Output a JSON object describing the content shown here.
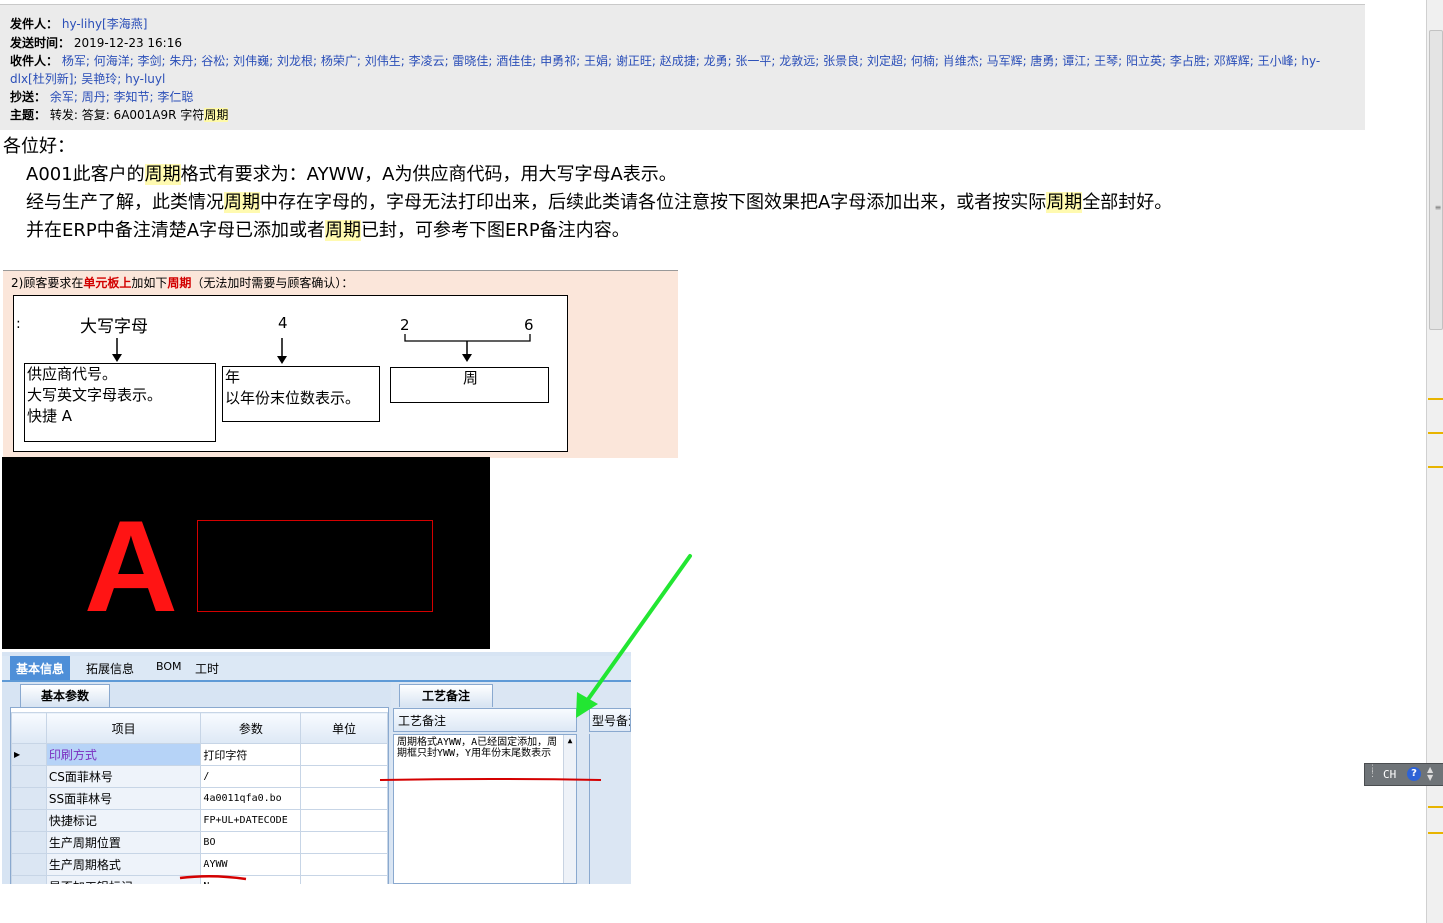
{
  "header": {
    "from_label": "发件人：",
    "from_value": "hy-lihy[李海燕]",
    "time_label": "发送时间：",
    "time_value": "2019-12-23 16:16",
    "to_label": "收件人：",
    "to_line1": "杨军; 何海洋; 李剑; 朱丹; 谷松; 刘伟巍; 刘龙根; 杨荣广; 刘伟生; 李凌云; 雷晓佳; 酒佳佳; 申勇祁; 王娟; 谢正旺; 赵成捷; 龙勇; 张一平; 龙敦远; 张景良; 刘定超; 何楠; 肖维杰; 马军辉; 唐勇; 谭江; 王琴; 阳立英; 李占胜; 邓辉辉; 王小峰; hy-",
    "to_line2": "dlx[杜列新]; 吴艳玲; hy-luyl",
    "cc_label": "抄送：",
    "cc_value": "余军; 周丹; 李知节; 李仁聪",
    "subject_label": "主题：",
    "subject_prefix": "转发: 答复: 6A001A9R 字符",
    "subject_hl": "周期"
  },
  "body": {
    "greeting": "各位好：",
    "p1_a": "A001此客户的",
    "p1_hl": "周期",
    "p1_b": "格式有要求为：AYWW，A为供应商代码，用大写字母A表示。",
    "p2_a": "经与生产了解，此类情况",
    "p2_hl1": "周期",
    "p2_b": "中存在字母的，字母无法打印出来，后续此类请各位注意按下图效果把A字母添加出来，或者按实际",
    "p2_hl2": "周期",
    "p2_c": "全部封好。",
    "p3_a": "并在ERP中备注清楚A字母已添加或者",
    "p3_hl": "周期",
    "p3_b": "已封，可参考下图ERP备注内容。"
  },
  "spec": {
    "cap_a": "2)顾客要求在",
    "cap_red1": "单元板上",
    "cap_b": "加如下",
    "cap_red2": "周期",
    "cap_c": "（无法加时需要与顾客确认）：",
    "label_letter": "大写字母",
    "label_4": "4",
    "label_2": "2",
    "label_6": "6",
    "box1_l1": "供应商代号。",
    "box1_l2": "大写英文字母表示。",
    "box1_l3": "快捷  A",
    "box2_l1": "年",
    "box2_l2": "以年份末位数表示。",
    "box3": "周"
  },
  "blackimg": {
    "letter": "A"
  },
  "erp": {
    "tabs": [
      "基本信息",
      "拓展信息",
      "BOM",
      "工时"
    ],
    "subtab": "基本参数",
    "columns": [
      "项目",
      "参数",
      "单位"
    ],
    "rows": [
      {
        "item": "印刷方式",
        "value": "打印字符"
      },
      {
        "item": "CS面菲林号",
        "value": "/"
      },
      {
        "item": "SS面菲林号",
        "value": "4a0011qfa0.bo"
      },
      {
        "item": "快捷标记",
        "value": "FP+UL+DATECODE"
      },
      {
        "item": "生产周期位置",
        "value": "BO"
      },
      {
        "item": "生产周期格式",
        "value": "AYWW"
      },
      {
        "item": "是否加工铝标记",
        "value": "N"
      }
    ],
    "right_tab": "工艺备注",
    "right_col1": "工艺备注",
    "right_col2": "型号备注",
    "note": "周期格式AYWW，A已经固定添加，周期框只封YWW，Y用年份末尾数表示"
  },
  "ime": {
    "lang": "CH",
    "help": "?"
  },
  "colors": {
    "arrow": "#22e632",
    "underline": "#d40000",
    "highlight": "#fffab0"
  }
}
